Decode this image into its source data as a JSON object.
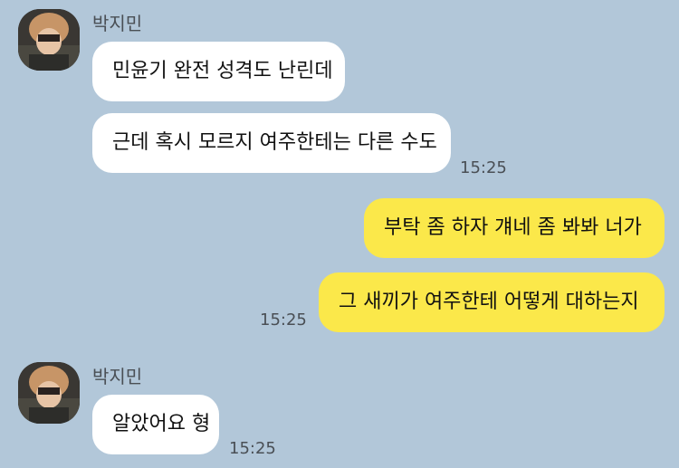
{
  "groups": [
    {
      "sender": "박지민",
      "messages": [
        "민윤기 완전 성격도 난린데",
        "근데 혹시 모르지 여주한테는 다른 수도"
      ],
      "time": "15:25"
    },
    {
      "sender": "",
      "messages": [
        "부탁 좀 하자 걔네 좀 봐봐 너가",
        "그 새끼가 여주한테 어떻게 대하는지"
      ],
      "time": "15:25"
    },
    {
      "sender": "박지민",
      "messages": [
        "알았어요 형"
      ],
      "time": "15:25"
    }
  ],
  "colors": {
    "background": "#b2c7d9",
    "incoming_bubble": "#ffffff",
    "outgoing_bubble": "#fbe84a",
    "meta_text": "#4a4f55"
  }
}
